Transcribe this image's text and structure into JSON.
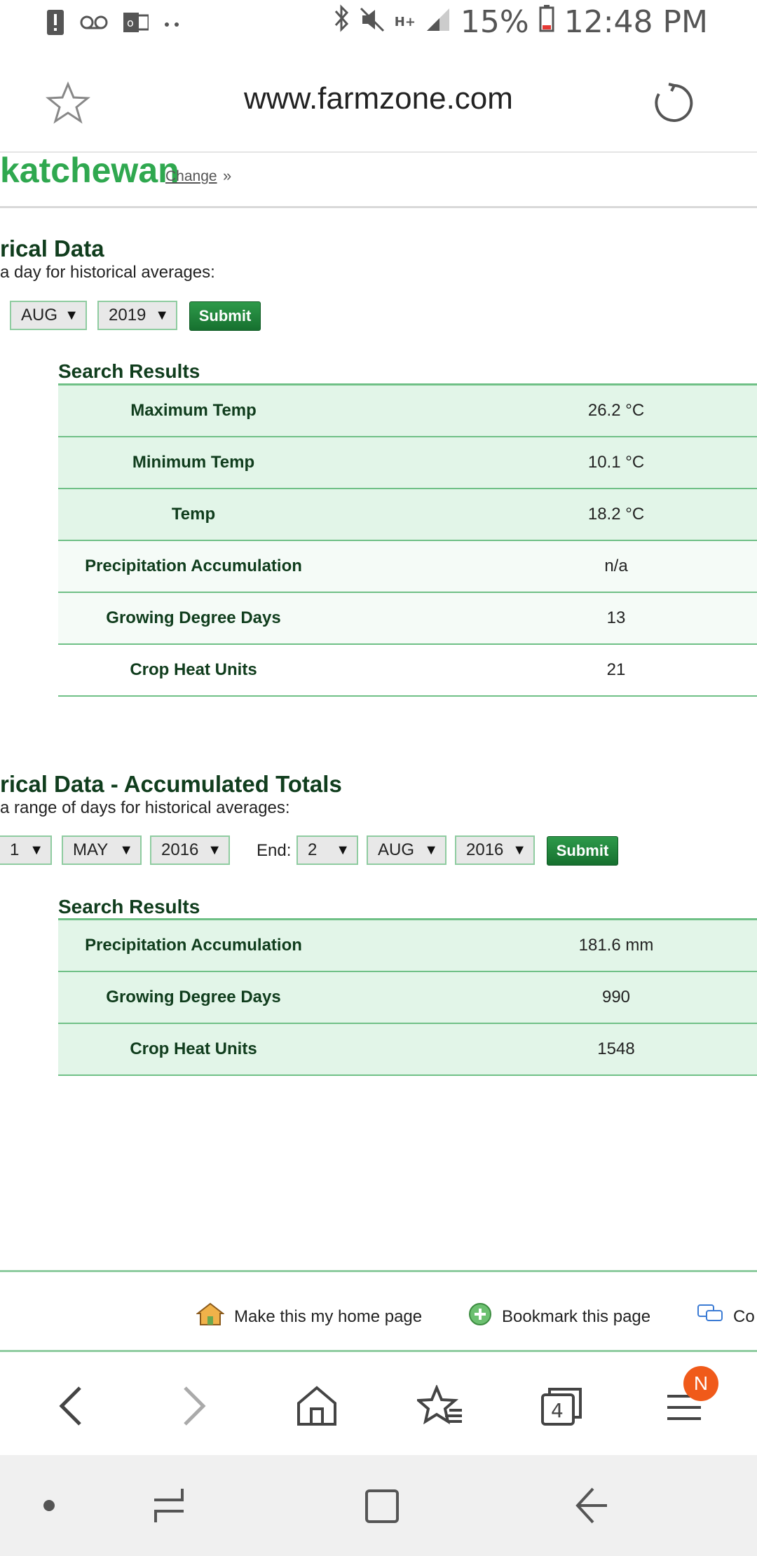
{
  "status_bar": {
    "battery": "15%",
    "time": "12:48 PM",
    "icons": [
      "alert-icon",
      "voicemail-icon",
      "outlook-icon",
      "more-dots-icon",
      "bluetooth-icon",
      "mute-icon",
      "hplus-icon",
      "signal-icon",
      "battery-icon"
    ],
    "network_label": "H+"
  },
  "browser": {
    "url": "www.farmzone.com"
  },
  "region": {
    "name": "katchewan",
    "change_label": "Change",
    "raquo": "»"
  },
  "historical": {
    "title": "rical Data",
    "subtitle": "a day for historical averages:",
    "month": "AUG",
    "year": "2019",
    "submit_label": "Submit",
    "results_title": "Search Results",
    "rows": [
      {
        "label": "Maximum Temp",
        "value": "26.2 °C"
      },
      {
        "label": "Minimum Temp",
        "value": "10.1 °C"
      },
      {
        "label": "Temp",
        "value": "18.2 °C"
      },
      {
        "label": "Precipitation Accumulation",
        "value": "n/a"
      },
      {
        "label": "Growing Degree Days",
        "value": "13"
      },
      {
        "label": "Crop Heat Units",
        "value": "21"
      }
    ]
  },
  "accumulated": {
    "title": "rical Data - Accumulated Totals",
    "subtitle": "a range of days for historical averages:",
    "start_day": "1",
    "start_month": "MAY",
    "start_year": "2016",
    "end_label": "End:",
    "end_day": "2",
    "end_month": "AUG",
    "end_year": "2016",
    "submit_label": "Submit",
    "results_title": "Search Results",
    "rows": [
      {
        "label": "Precipitation Accumulation",
        "value": "181.6 mm"
      },
      {
        "label": "Growing Degree Days",
        "value": "990"
      },
      {
        "label": "Crop Heat Units",
        "value": "1548"
      }
    ]
  },
  "footer": {
    "home_page_label": "Make this my home page",
    "bookmark_label": "Bookmark this page",
    "comment_label": "Co"
  },
  "bottom_nav": {
    "tabs_count": "4",
    "badge": "N"
  },
  "colors": {
    "accent_green": "#2fa84f",
    "table_border": "#6fc086",
    "badge_orange": "#f05a1a"
  }
}
